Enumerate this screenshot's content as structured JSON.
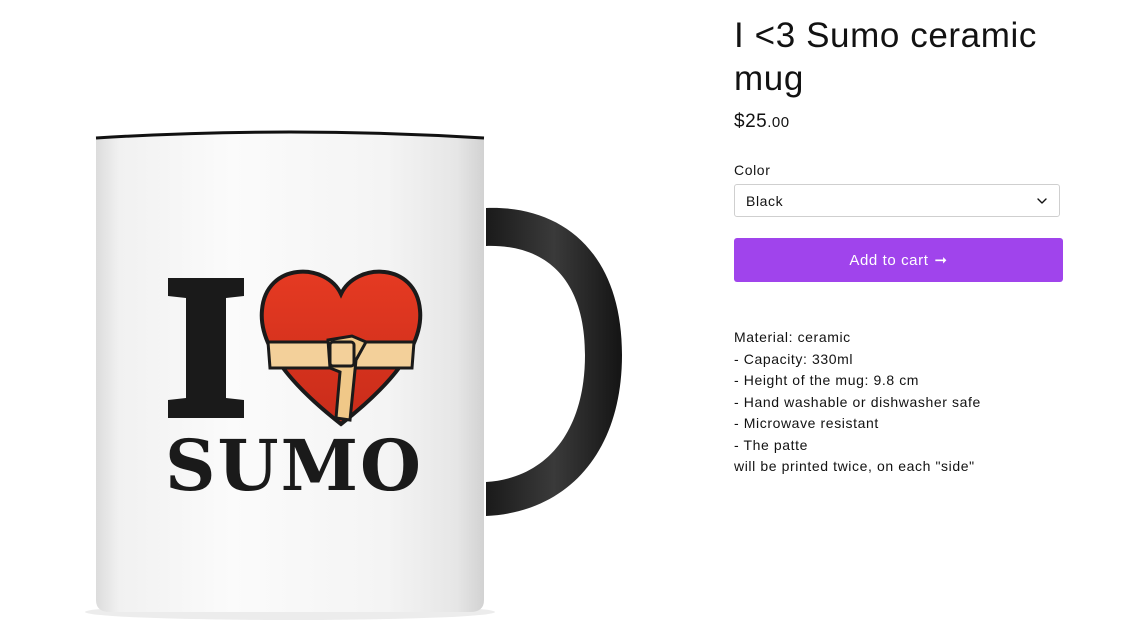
{
  "product": {
    "title": "I <3 Sumo ceramic mug",
    "price_main": "$25",
    "price_cents": ".00",
    "image": {
      "logo_text_letter": "I",
      "logo_text_word": "SUMO"
    }
  },
  "variant": {
    "label": "Color",
    "selected": "Black",
    "icon": "chevron-down-icon"
  },
  "actions": {
    "add_to_cart_label": "Add to cart",
    "add_to_cart_icon": "arrow-right-icon",
    "button_color": "#a044ec"
  },
  "description": {
    "lines": [
      "Material: ceramic",
      "- Capacity: 330ml",
      "- Height of the mug: 9.8 cm",
      "- Hand washable or dishwasher safe",
      "- Microwave resistant",
      "- The patte",
      "will be printed twice, on each \"side\""
    ]
  }
}
